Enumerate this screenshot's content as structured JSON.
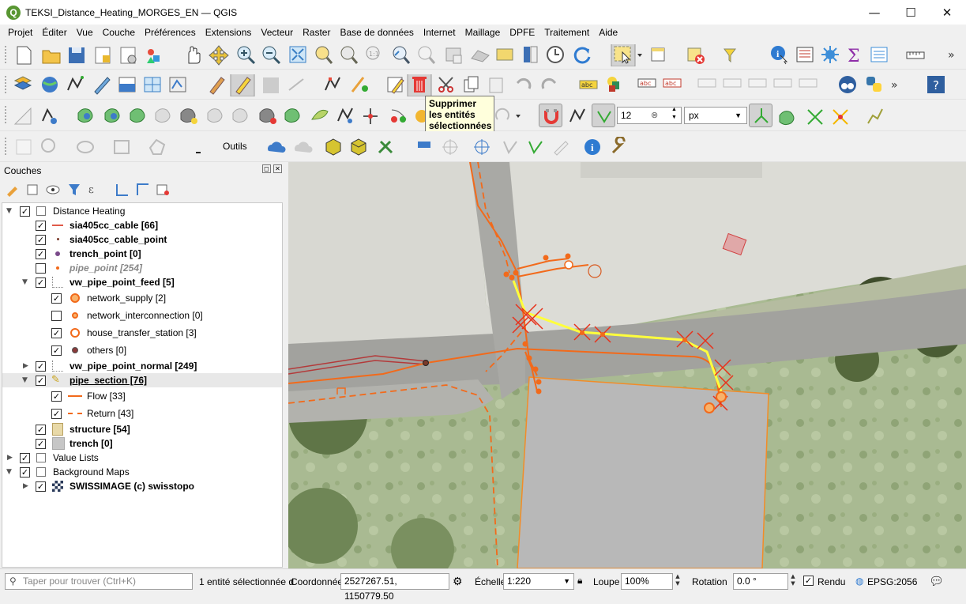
{
  "window": {
    "title": "TEKSI_Distance_Heating_MORGES_EN — QGIS",
    "minimize_glyph": "—",
    "maximize_glyph": "☐",
    "close_glyph": "✕"
  },
  "menu": [
    "Projet",
    "Éditer",
    "Vue",
    "Couche",
    "Préférences",
    "Extensions",
    "Vecteur",
    "Raster",
    "Base de données",
    "Internet",
    "Maillage",
    "DPFE",
    "Traitement",
    "Aide"
  ],
  "toolbars": {
    "snapping_tolerance": "12",
    "snapping_units": "px",
    "tools_label": "Outils"
  },
  "tooltip": {
    "text": "Supprimer les entités sélectionnées"
  },
  "layers_panel": {
    "title": "Couches",
    "tree": [
      {
        "label": "Distance Heating",
        "checked": true
      },
      {
        "label": "sia405cc_cable [66]",
        "checked": true
      },
      {
        "label": "sia405cc_cable_point",
        "checked": true
      },
      {
        "label": "trench_point [0]",
        "checked": true
      },
      {
        "label": "pipe_point [254]",
        "checked": false
      },
      {
        "label": "vw_pipe_point_feed [5]",
        "checked": true
      },
      {
        "label": "network_supply [2]",
        "checked": true
      },
      {
        "label": "network_interconnection [0]",
        "checked": false
      },
      {
        "label": "house_transfer_station [3]",
        "checked": true
      },
      {
        "label": "others [0]",
        "checked": true
      },
      {
        "label": "vw_pipe_point_normal [249]",
        "checked": true
      },
      {
        "label": "pipe_section [76]",
        "checked": true
      },
      {
        "label": "Flow [33]",
        "checked": true
      },
      {
        "label": "Return [43]",
        "checked": true
      },
      {
        "label": "structure [54]",
        "checked": true
      },
      {
        "label": "trench [0]",
        "checked": true
      },
      {
        "label": "Value Lists",
        "checked": true
      },
      {
        "label": "Background Maps",
        "checked": true
      },
      {
        "label": "SWISSIMAGE (c) swisstopo",
        "checked": true
      }
    ],
    "check_glyph": "✓"
  },
  "status": {
    "search_placeholder": "Taper pour trouver (Ctrl+K)",
    "selection_message": "1 entité sélectionnée d",
    "coordinate_label": "Coordonnée",
    "coordinate_value": "2527267.51, 1150779.50",
    "scale_label": "Échelle",
    "scale_value": "1:220",
    "magnifier_label": "Loupe",
    "magnifier_value": "100%",
    "rotation_label": "Rotation",
    "rotation_value": "0.0 °",
    "render_label": "Rendu",
    "crs": "EPSG:2056"
  },
  "colors": {
    "pipe_orange": "#f26a1b",
    "selection_yellow": "#ffff3c",
    "selected_cross": "#e8311a",
    "structure_fill": "#b8b8b8",
    "structure_outline": "#f28c28"
  }
}
